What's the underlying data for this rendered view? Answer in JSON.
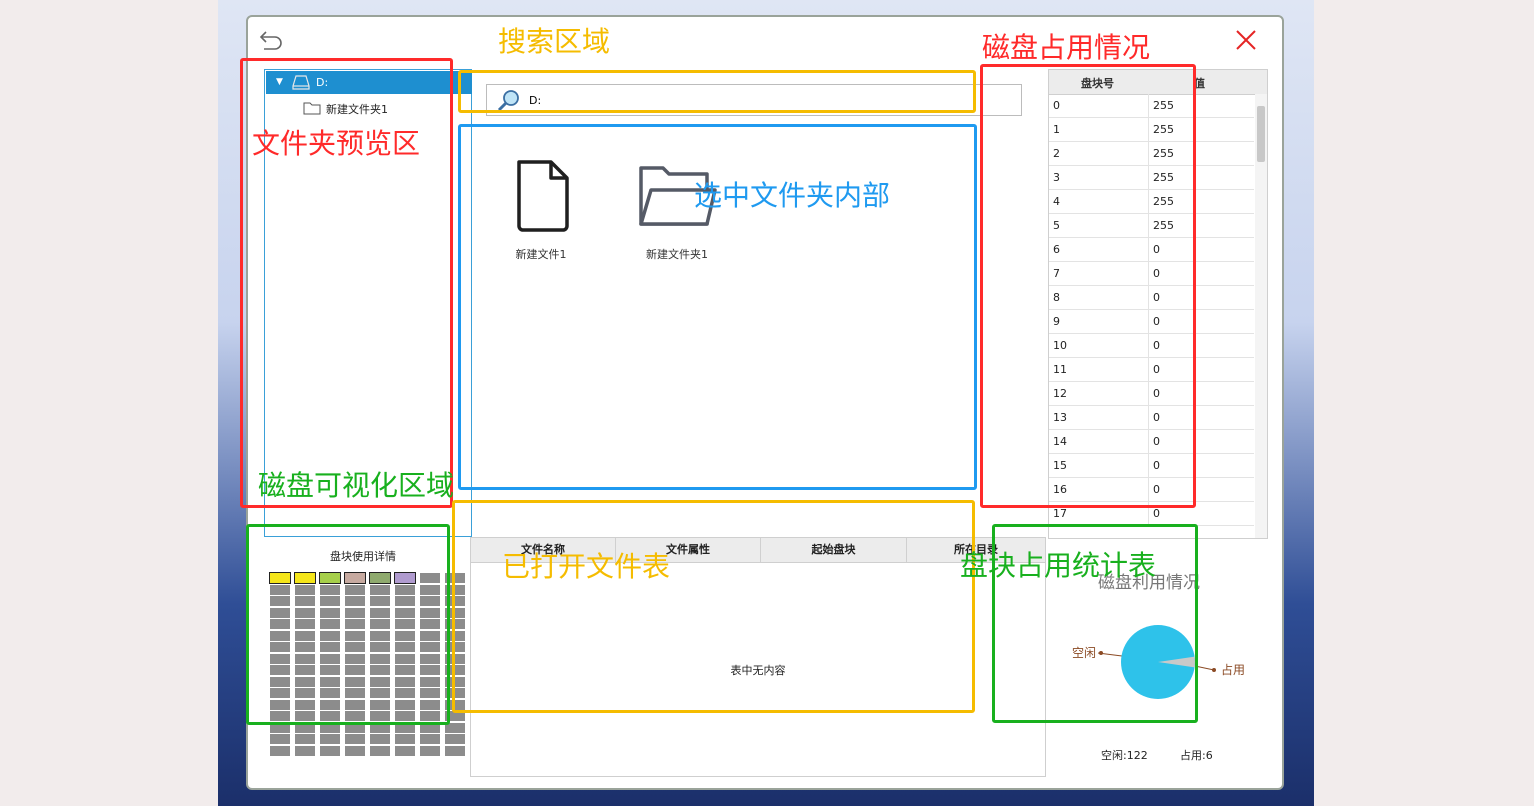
{
  "window": {
    "close_glyph": "✕"
  },
  "tree": {
    "root_label": "D:",
    "children": [
      {
        "label": "新建文件夹1"
      }
    ]
  },
  "search": {
    "value": "D:",
    "placeholder": ""
  },
  "content": {
    "items": [
      {
        "label": "新建文件1",
        "icon": "file-icon"
      },
      {
        "label": "新建文件夹1",
        "icon": "folder-icon"
      }
    ]
  },
  "disk_table": {
    "headers": [
      "盘块号",
      "值"
    ],
    "rows": [
      [
        "0",
        "255"
      ],
      [
        "1",
        "255"
      ],
      [
        "2",
        "255"
      ],
      [
        "3",
        "255"
      ],
      [
        "4",
        "255"
      ],
      [
        "5",
        "255"
      ],
      [
        "6",
        "0"
      ],
      [
        "7",
        "0"
      ],
      [
        "8",
        "0"
      ],
      [
        "9",
        "0"
      ],
      [
        "10",
        "0"
      ],
      [
        "11",
        "0"
      ],
      [
        "12",
        "0"
      ],
      [
        "13",
        "0"
      ],
      [
        "14",
        "0"
      ],
      [
        "15",
        "0"
      ],
      [
        "16",
        "0"
      ],
      [
        "17",
        "0"
      ]
    ]
  },
  "block_usage": {
    "title": "盘块使用详情",
    "columns": 8,
    "rows": 16,
    "used_colors": [
      "#f5e61a",
      "#f5e61a",
      "#a6cf4a",
      "#c7aaa0",
      "#8faa6e",
      "#b09bcf"
    ],
    "free_color": "#8c8c8c"
  },
  "opened_files": {
    "headers": [
      "文件名称",
      "文件属性",
      "起始盘块",
      "所在目录"
    ],
    "empty_text": "表中无内容"
  },
  "pie": {
    "title": "磁盘利用情况",
    "free_label": "空闲",
    "used_label": "占用",
    "free_count": 122,
    "used_count": 6,
    "free_stat": "空闲:122",
    "used_stat": "占用:6",
    "colors": {
      "free": "#2ec2ea",
      "used": "#c9c9c9"
    }
  },
  "annotations": [
    {
      "text": "搜索区域",
      "color": "#f5bc00"
    },
    {
      "text": "磁盘占用情况",
      "color": "#ff2a2a"
    },
    {
      "text": "文件夹预览区",
      "color": "#ff2a2a"
    },
    {
      "text": "选中文件夹内部",
      "color": "#1f9af0"
    },
    {
      "text": "磁盘可视化区域",
      "color": "#18b01e"
    },
    {
      "text": "已打开文件表",
      "color": "#f5bc00"
    },
    {
      "text": "盘块占用统计表",
      "color": "#18b01e"
    }
  ]
}
